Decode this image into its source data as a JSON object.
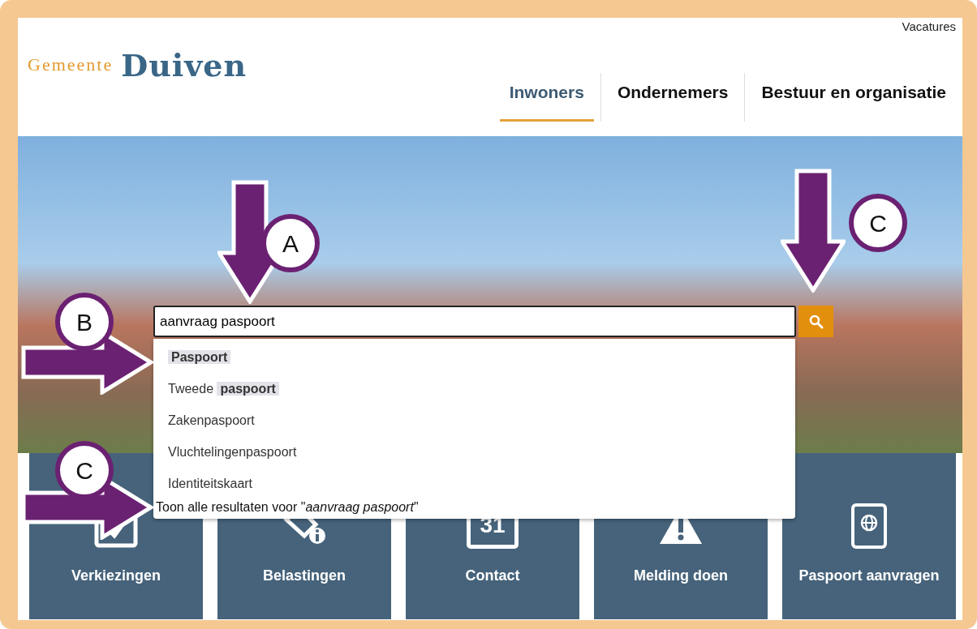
{
  "header": {
    "top_link": "Vacatures",
    "logo": {
      "prefix": "Gemeente",
      "name": "Duiven"
    },
    "nav": [
      {
        "label": "Inwoners",
        "selected": true
      },
      {
        "label": "Ondernemers",
        "selected": false
      },
      {
        "label": "Bestuur en organisatie",
        "selected": false
      }
    ]
  },
  "search": {
    "value": "aanvraag paspoort",
    "suggestions": [
      "**Paspoort**",
      "Tweede **paspoort**",
      "Zakenpaspoort",
      "Vluchtelingenpaspoort",
      "Identiteitskaart"
    ],
    "show_all": "Toon alle resultaten voor \"*aanvraag paspoort*\""
  },
  "tiles": [
    {
      "kind": "ballot",
      "label": "Verkiezingen"
    },
    {
      "kind": "tag",
      "label": "Belastingen"
    },
    {
      "kind": "calendar",
      "icon_text": "31",
      "label": "Contact"
    },
    {
      "kind": "warning",
      "label": "Melding doen"
    },
    {
      "kind": "passport",
      "label": "Paspoort aanvragen"
    }
  ],
  "annotations": [
    {
      "label": "A",
      "kind": "down"
    },
    {
      "label": "C",
      "kind": "down"
    },
    {
      "label": "B",
      "kind": "right"
    },
    {
      "label": "C",
      "kind": "right"
    }
  ]
}
